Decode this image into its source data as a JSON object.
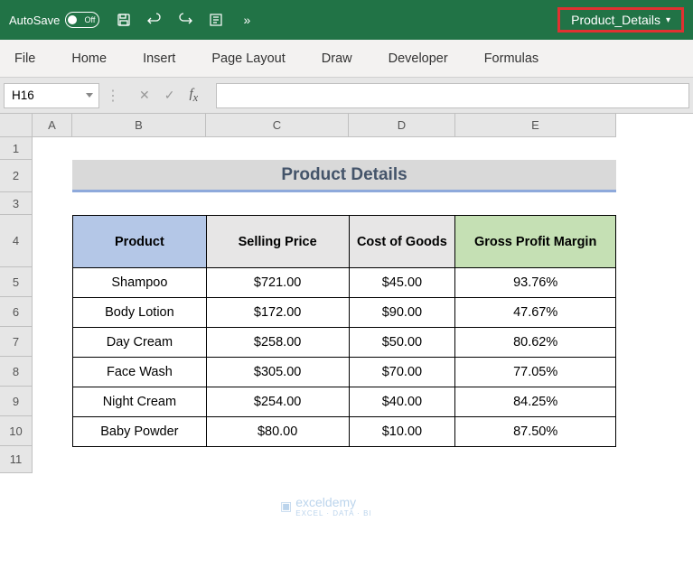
{
  "titleBar": {
    "autosave": "AutoSave",
    "toggleState": "Off",
    "docName": "Product_Details"
  },
  "ribbonTabs": [
    "File",
    "Home",
    "Insert",
    "Page Layout",
    "Draw",
    "Developer",
    "Formulas"
  ],
  "nameBox": "H16",
  "columns": [
    "A",
    "B",
    "C",
    "D",
    "E"
  ],
  "rows": [
    "1",
    "2",
    "3",
    "4",
    "5",
    "6",
    "7",
    "8",
    "9",
    "10",
    "11"
  ],
  "sheetTitle": "Product Details",
  "tableHeaders": {
    "product": "Product",
    "selling": "Selling Price",
    "cost": "Cost of Goods",
    "gross": "Gross Profit Margin"
  },
  "tableRows": [
    {
      "product": "Shampoo",
      "selling": "$721.00",
      "cost": "$45.00",
      "gross": "93.76%"
    },
    {
      "product": "Body Lotion",
      "selling": "$172.00",
      "cost": "$90.00",
      "gross": "47.67%"
    },
    {
      "product": "Day Cream",
      "selling": "$258.00",
      "cost": "$50.00",
      "gross": "80.62%"
    },
    {
      "product": "Face Wash",
      "selling": "$305.00",
      "cost": "$70.00",
      "gross": "77.05%"
    },
    {
      "product": "Night Cream",
      "selling": "$254.00",
      "cost": "$40.00",
      "gross": "84.25%"
    },
    {
      "product": "Baby Powder",
      "selling": "$80.00",
      "cost": "$10.00",
      "gross": "87.50%"
    }
  ],
  "watermark": {
    "brand": "exceldemy",
    "sub": "EXCEL · DATA · BI"
  }
}
